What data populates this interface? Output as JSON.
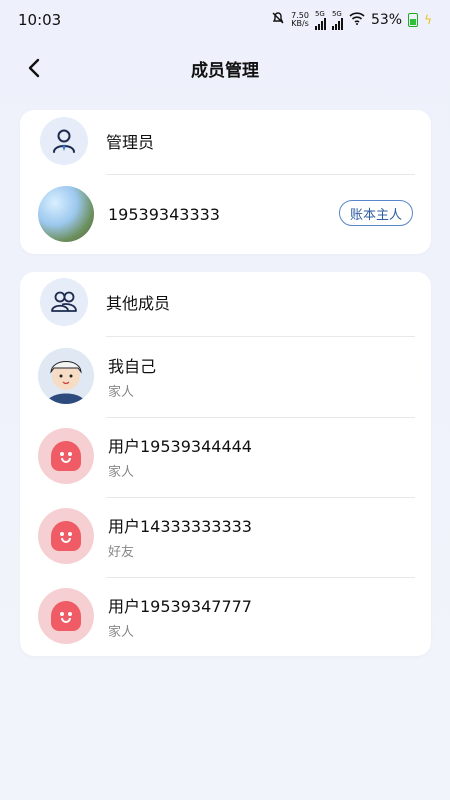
{
  "status": {
    "time": "10:03",
    "net_speed_value": "7.50",
    "net_speed_unit": "KB/s",
    "sim1": "5G",
    "sim2": "5G",
    "battery": "53%"
  },
  "header": {
    "title": "成员管理",
    "back_icon": "chevron-left-icon"
  },
  "admin_section": {
    "label": "管理员",
    "icon": "person-icon",
    "member": {
      "name": "19539343333",
      "badge": "账本主人"
    }
  },
  "others_section": {
    "label": "其他成员",
    "icon": "people-icon",
    "members": [
      {
        "name": "我自己",
        "role": "家人"
      },
      {
        "name": "用户19539344444",
        "role": "家人"
      },
      {
        "name": "用户14333333333",
        "role": "好友"
      },
      {
        "name": "用户19539347777",
        "role": "家人"
      }
    ]
  },
  "colors": {
    "accent": "#5b87c8",
    "icon_bg": "#e6ecf8",
    "avatar_pink": "#f6cfd3",
    "ghost": "#ef5c65"
  }
}
